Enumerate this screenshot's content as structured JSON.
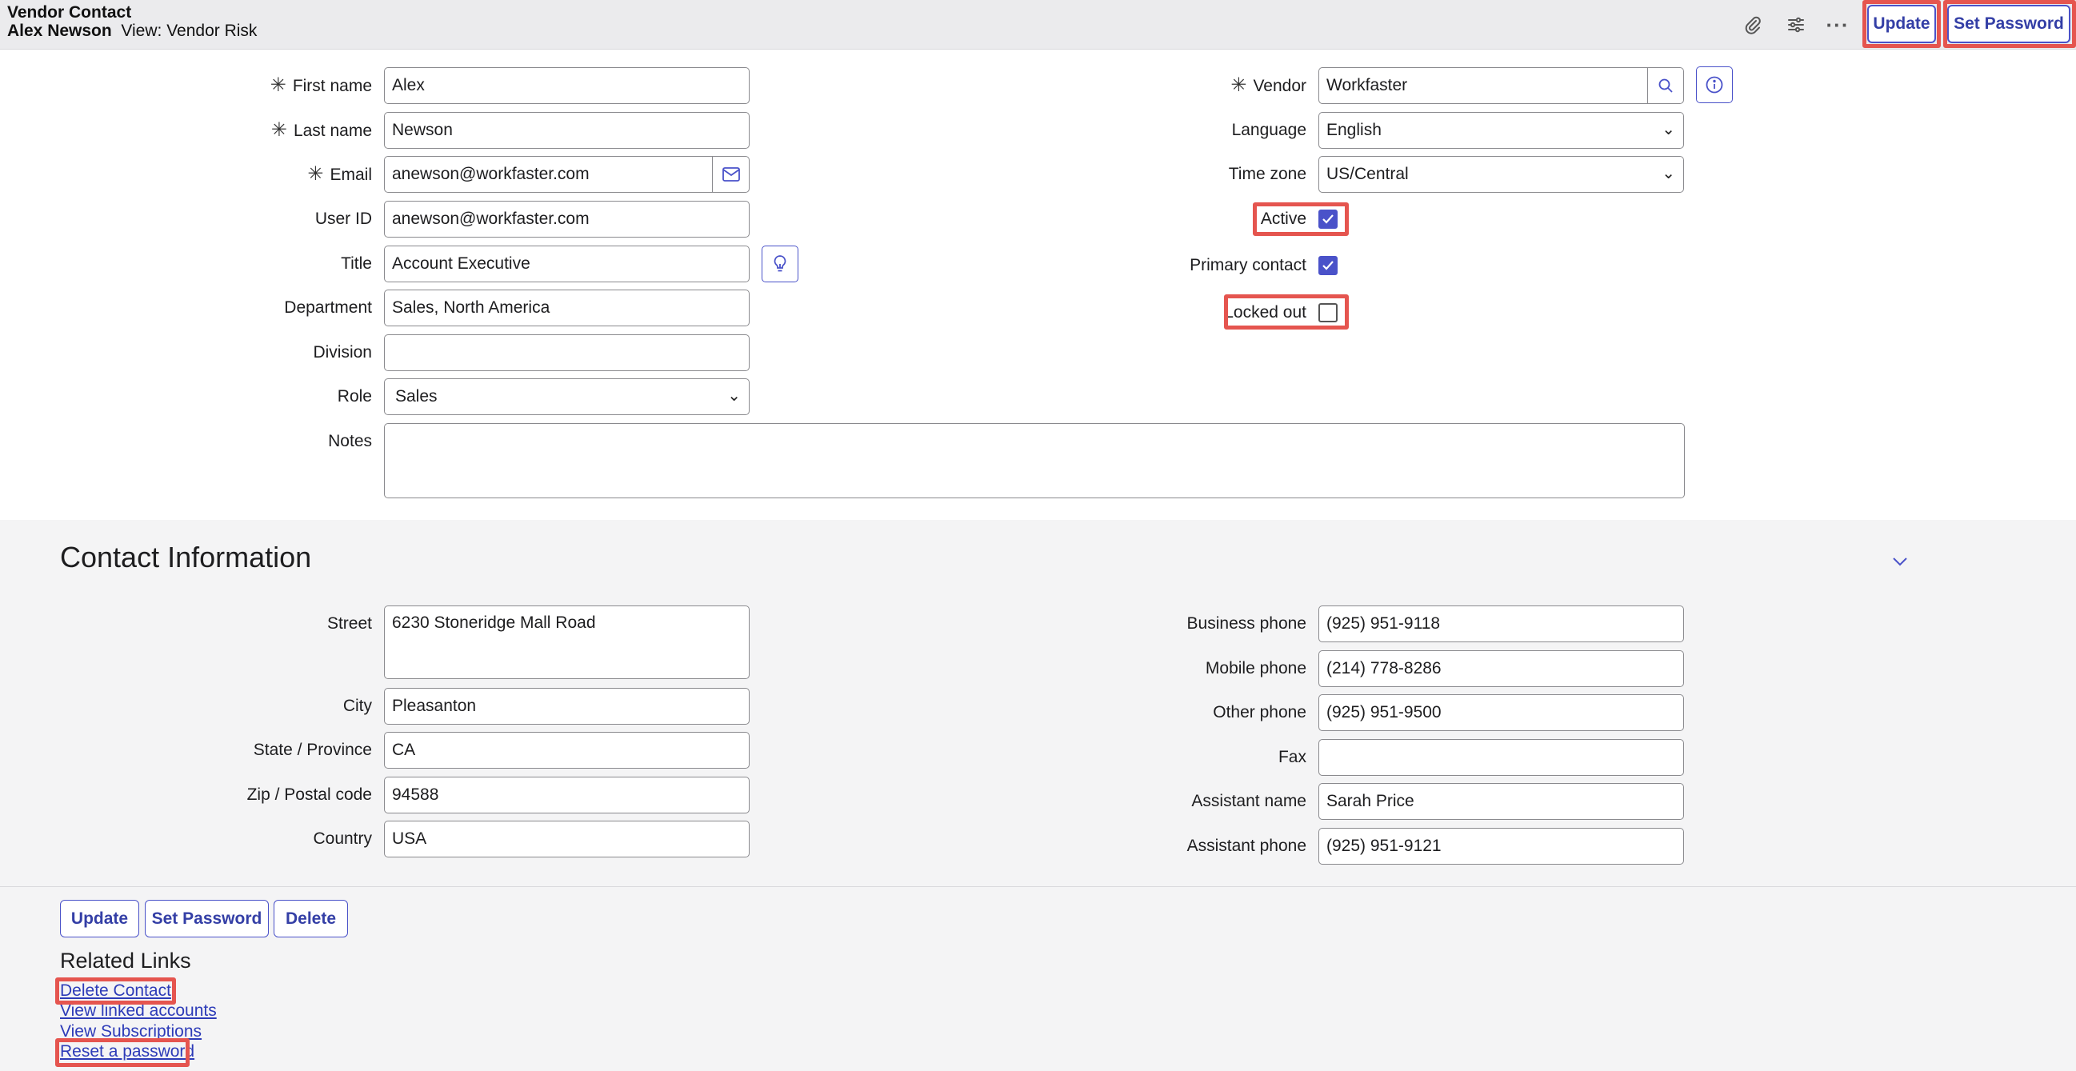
{
  "header": {
    "title": "Vendor Contact",
    "record_name": "Alex Newson",
    "view_label": "View: Vendor Risk",
    "icons": [
      "attachment-icon",
      "settings-sliders-icon",
      "more-icon"
    ],
    "update_label": "Update",
    "set_password_label": "Set Password"
  },
  "form": {
    "first_name": {
      "label": "First name",
      "value": "Alex"
    },
    "last_name": {
      "label": "Last name",
      "value": "Newson"
    },
    "email": {
      "label": "Email",
      "value": "anewson@workfaster.com"
    },
    "user_id": {
      "label": "User ID",
      "value": "anewson@workfaster.com"
    },
    "title": {
      "label": "Title",
      "value": "Account Executive"
    },
    "department": {
      "label": "Department",
      "value": "Sales, North America"
    },
    "division": {
      "label": "Division",
      "value": ""
    },
    "role": {
      "label": "Role",
      "value": "Sales"
    },
    "notes": {
      "label": "Notes",
      "value": ""
    },
    "vendor": {
      "label": "Vendor",
      "value": "Workfaster"
    },
    "language": {
      "label": "Language",
      "value": "English"
    },
    "time_zone": {
      "label": "Time zone",
      "value": "US/Central"
    },
    "active": {
      "label": "Active",
      "checked": true
    },
    "primary_contact": {
      "label": "Primary contact",
      "checked": true
    },
    "locked_out": {
      "label": "Locked out",
      "checked": false
    }
  },
  "contact_info": {
    "title": "Contact Information",
    "street": {
      "label": "Street",
      "value": "6230 Stoneridge Mall Road"
    },
    "city": {
      "label": "City",
      "value": "Pleasanton"
    },
    "state": {
      "label": "State / Province",
      "value": "CA"
    },
    "zip": {
      "label": "Zip / Postal code",
      "value": "94588"
    },
    "country": {
      "label": "Country",
      "value": "USA"
    },
    "business_phone": {
      "label": "Business phone",
      "value": "(925) 951-9118"
    },
    "mobile_phone": {
      "label": "Mobile phone",
      "value": "(214) 778-8286"
    },
    "other_phone": {
      "label": "Other phone",
      "value": "(925) 951-9500"
    },
    "fax": {
      "label": "Fax",
      "value": ""
    },
    "assistant_name": {
      "label": "Assistant name",
      "value": "Sarah Price"
    },
    "assistant_phone": {
      "label": "Assistant phone",
      "value": "(925) 951-9121"
    }
  },
  "footer": {
    "update_label": "Update",
    "set_password_label": "Set Password",
    "delete_label": "Delete"
  },
  "related_links": {
    "title": "Related Links",
    "items": [
      "Delete Contact",
      "View linked accounts",
      "View Subscriptions",
      "Reset a password"
    ]
  },
  "colors": {
    "accent": "#4a52c9",
    "highlight": "#e5554f",
    "header_bg": "#ebebed",
    "section_bg": "#f4f4f5"
  }
}
